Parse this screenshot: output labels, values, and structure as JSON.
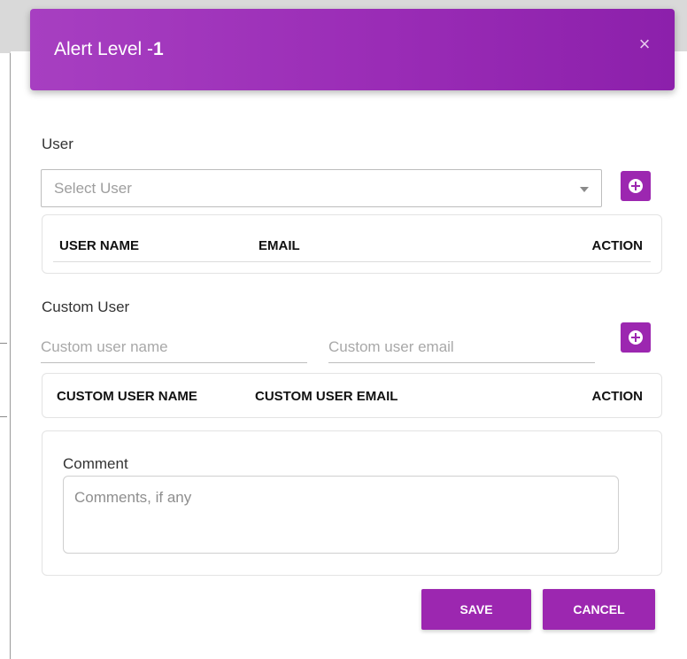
{
  "modal": {
    "title": "Alert Level - ",
    "level": "1",
    "close_icon": "close-icon"
  },
  "user_section": {
    "label": "User",
    "select_placeholder": "Select User",
    "add_icon": "plus-circle-icon",
    "table_headers": [
      "USER NAME",
      "EMAIL",
      "ACTION"
    ]
  },
  "custom_user_section": {
    "label": "Custom User",
    "name_placeholder": "Custom user name",
    "email_placeholder": "Custom user email",
    "add_icon": "plus-circle-icon",
    "table_headers": [
      "CUSTOM USER NAME",
      "CUSTOM USER EMAIL",
      "ACTION"
    ]
  },
  "comment_section": {
    "label": "Comment",
    "placeholder": "Comments, if any"
  },
  "footer": {
    "save_label": "SAVE",
    "cancel_label": "CANCEL"
  },
  "colors": {
    "accent": "#9c27b0",
    "header_gradient_start": "#a73fc1",
    "header_gradient_end": "#8c20ab"
  }
}
